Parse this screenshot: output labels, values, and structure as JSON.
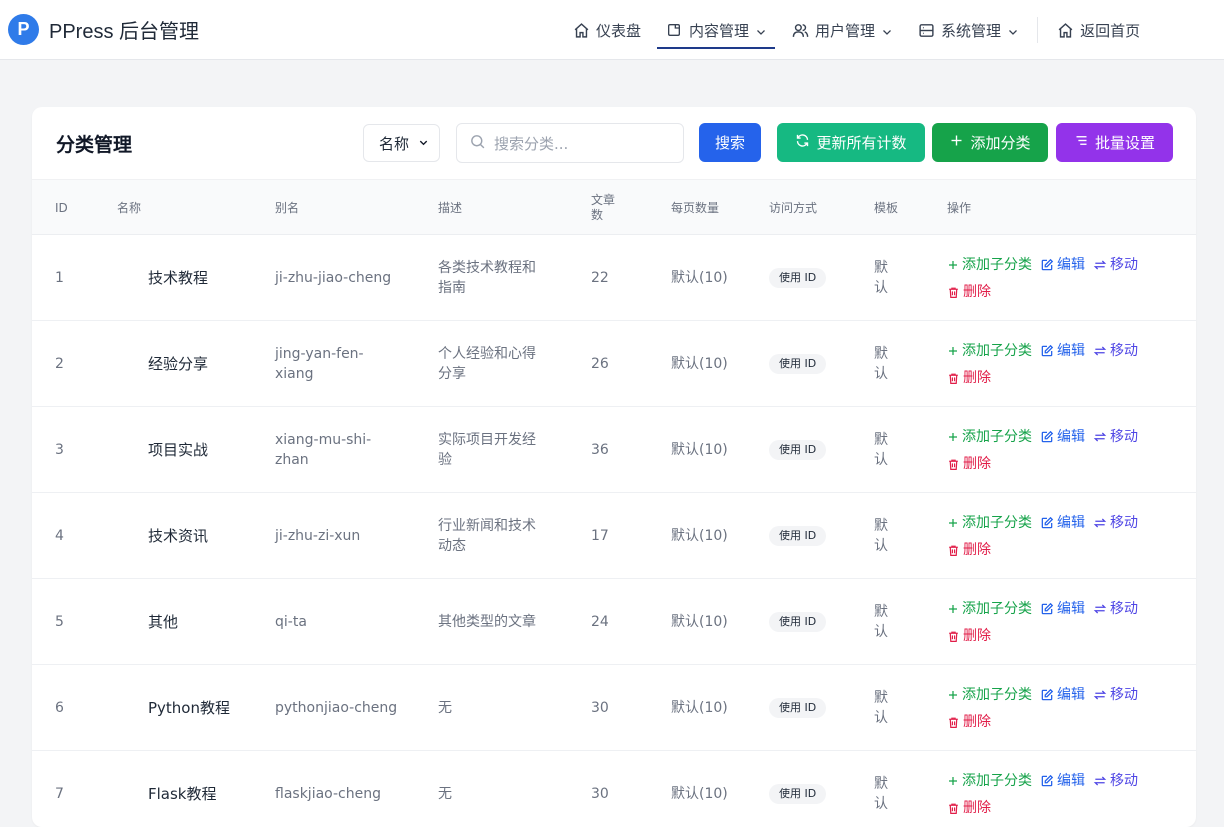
{
  "brand": {
    "logo_letter": "P",
    "name": "PPress 后台管理"
  },
  "nav": [
    {
      "label": "仪表盘",
      "icon": "home-icon"
    },
    {
      "label": "内容管理",
      "icon": "document-icon",
      "active": true
    },
    {
      "label": "用户管理",
      "icon": "users-icon"
    },
    {
      "label": "系统管理",
      "icon": "server-icon"
    },
    {
      "label": "返回首页",
      "icon": "home-icon"
    }
  ],
  "page": {
    "title": "分类管理",
    "filter_select": "名称",
    "search_placeholder": "搜索分类...",
    "buttons": {
      "search": "搜索",
      "update_counts": "更新所有计数",
      "add_category": "添加分类",
      "batch_settings": "批量设置"
    }
  },
  "table": {
    "headers": {
      "id": "ID",
      "name": "名称",
      "slug": "别名",
      "desc": "描述",
      "count": "文章数",
      "per_page": "每页数量",
      "access": "访问方式",
      "template": "模板",
      "ops": "操作"
    },
    "actions": {
      "add_child": "添加子分类",
      "edit": "编辑",
      "move": "移动",
      "delete": "删除"
    },
    "rows": [
      {
        "id": "1",
        "name": "技术教程",
        "slug": "ji-zhu-jiao-cheng",
        "desc": "各类技术教程和指南",
        "count": "22",
        "per_page": "默认(10)",
        "access": "使用 ID",
        "template": "默认"
      },
      {
        "id": "2",
        "name": "经验分享",
        "slug": "jing-yan-fen-xiang",
        "desc": "个人经验和心得分享",
        "count": "26",
        "per_page": "默认(10)",
        "access": "使用 ID",
        "template": "默认"
      },
      {
        "id": "3",
        "name": "项目实战",
        "slug": "xiang-mu-shi-zhan",
        "desc": "实际项目开发经验",
        "count": "36",
        "per_page": "默认(10)",
        "access": "使用 ID",
        "template": "默认"
      },
      {
        "id": "4",
        "name": "技术资讯",
        "slug": "ji-zhu-zi-xun",
        "desc": "行业新闻和技术动态",
        "count": "17",
        "per_page": "默认(10)",
        "access": "使用 ID",
        "template": "默认"
      },
      {
        "id": "5",
        "name": "其他",
        "slug": "qi-ta",
        "desc": "其他类型的文章",
        "count": "24",
        "per_page": "默认(10)",
        "access": "使用 ID",
        "template": "默认"
      },
      {
        "id": "6",
        "name": "Python教程",
        "slug": "pythonjiao-cheng",
        "desc": "无",
        "count": "30",
        "per_page": "默认(10)",
        "access": "使用 ID",
        "template": "默认"
      },
      {
        "id": "7",
        "name": "Flask教程",
        "slug": "flaskjiao-cheng",
        "desc": "无",
        "count": "30",
        "per_page": "默认(10)",
        "access": "使用 ID",
        "template": "默认"
      }
    ]
  },
  "colors": {
    "primary": "#2563eb",
    "teal": "#16b982",
    "green": "#16a34a",
    "purple": "#9333ea",
    "danger": "#e11d48",
    "indigo": "#4f46e5"
  }
}
